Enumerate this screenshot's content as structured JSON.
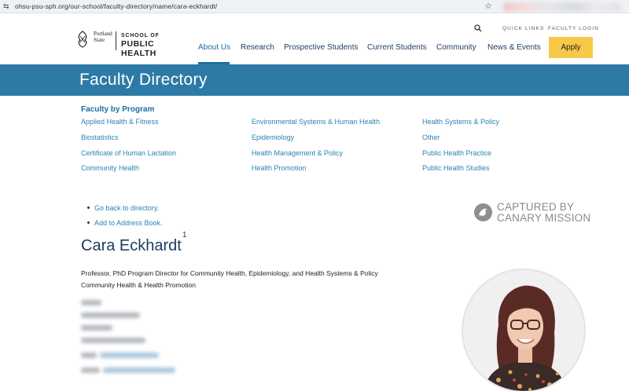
{
  "browser": {
    "url": "ohsu-psu-sph.org/our-school/faculty-directory/name/cara-eckhardt/",
    "icons": [
      "site-settings-icon",
      "star-icon"
    ]
  },
  "header": {
    "logo": {
      "partner_text": "Portland State",
      "school_line1": "SCHOOL OF",
      "school_line2": "PUBLIC HEALTH"
    },
    "utility": {
      "quick_links": "QUICK LINKS",
      "faculty_login": "FACULTY LOGIN",
      "search_icon": "search-icon"
    },
    "nav": {
      "about": "About Us",
      "research": "Research",
      "prospective": "Prospective Students",
      "current": "Current Students",
      "community": "Community",
      "news": "News & Events",
      "apply": "Apply"
    }
  },
  "banner": {
    "title": "Faculty Directory"
  },
  "programs": {
    "heading": "Faculty by Program",
    "items": [
      "Applied Health & Fitness",
      "Biostatistics",
      "Certificate of Human Lactation",
      "Community Health",
      "Environmental Systems & Human Health",
      "Epidemiology",
      "Health Management & Policy",
      "Health Promotion",
      "Health Systems & Policy",
      "Other",
      "Public Health Practice",
      "Public Health Studies"
    ]
  },
  "links": {
    "back": "Go back to directory.",
    "address": "Add to Address Book."
  },
  "person": {
    "name": "Cara Eckhardt",
    "footnote": "1",
    "title_line1": "Professor, PhD Program Director for Community Health, Epidemiology, and Health Systems & Policy",
    "title_line2": "Community Health & Health Promotion"
  },
  "watermark": {
    "line1": "CAPTURED BY",
    "line2": "CANARY MISSION"
  },
  "colors": {
    "banner": "#2d7aa6",
    "link": "#2b83b3",
    "apply": "#f7c948",
    "navy": "#1e3a5f"
  }
}
